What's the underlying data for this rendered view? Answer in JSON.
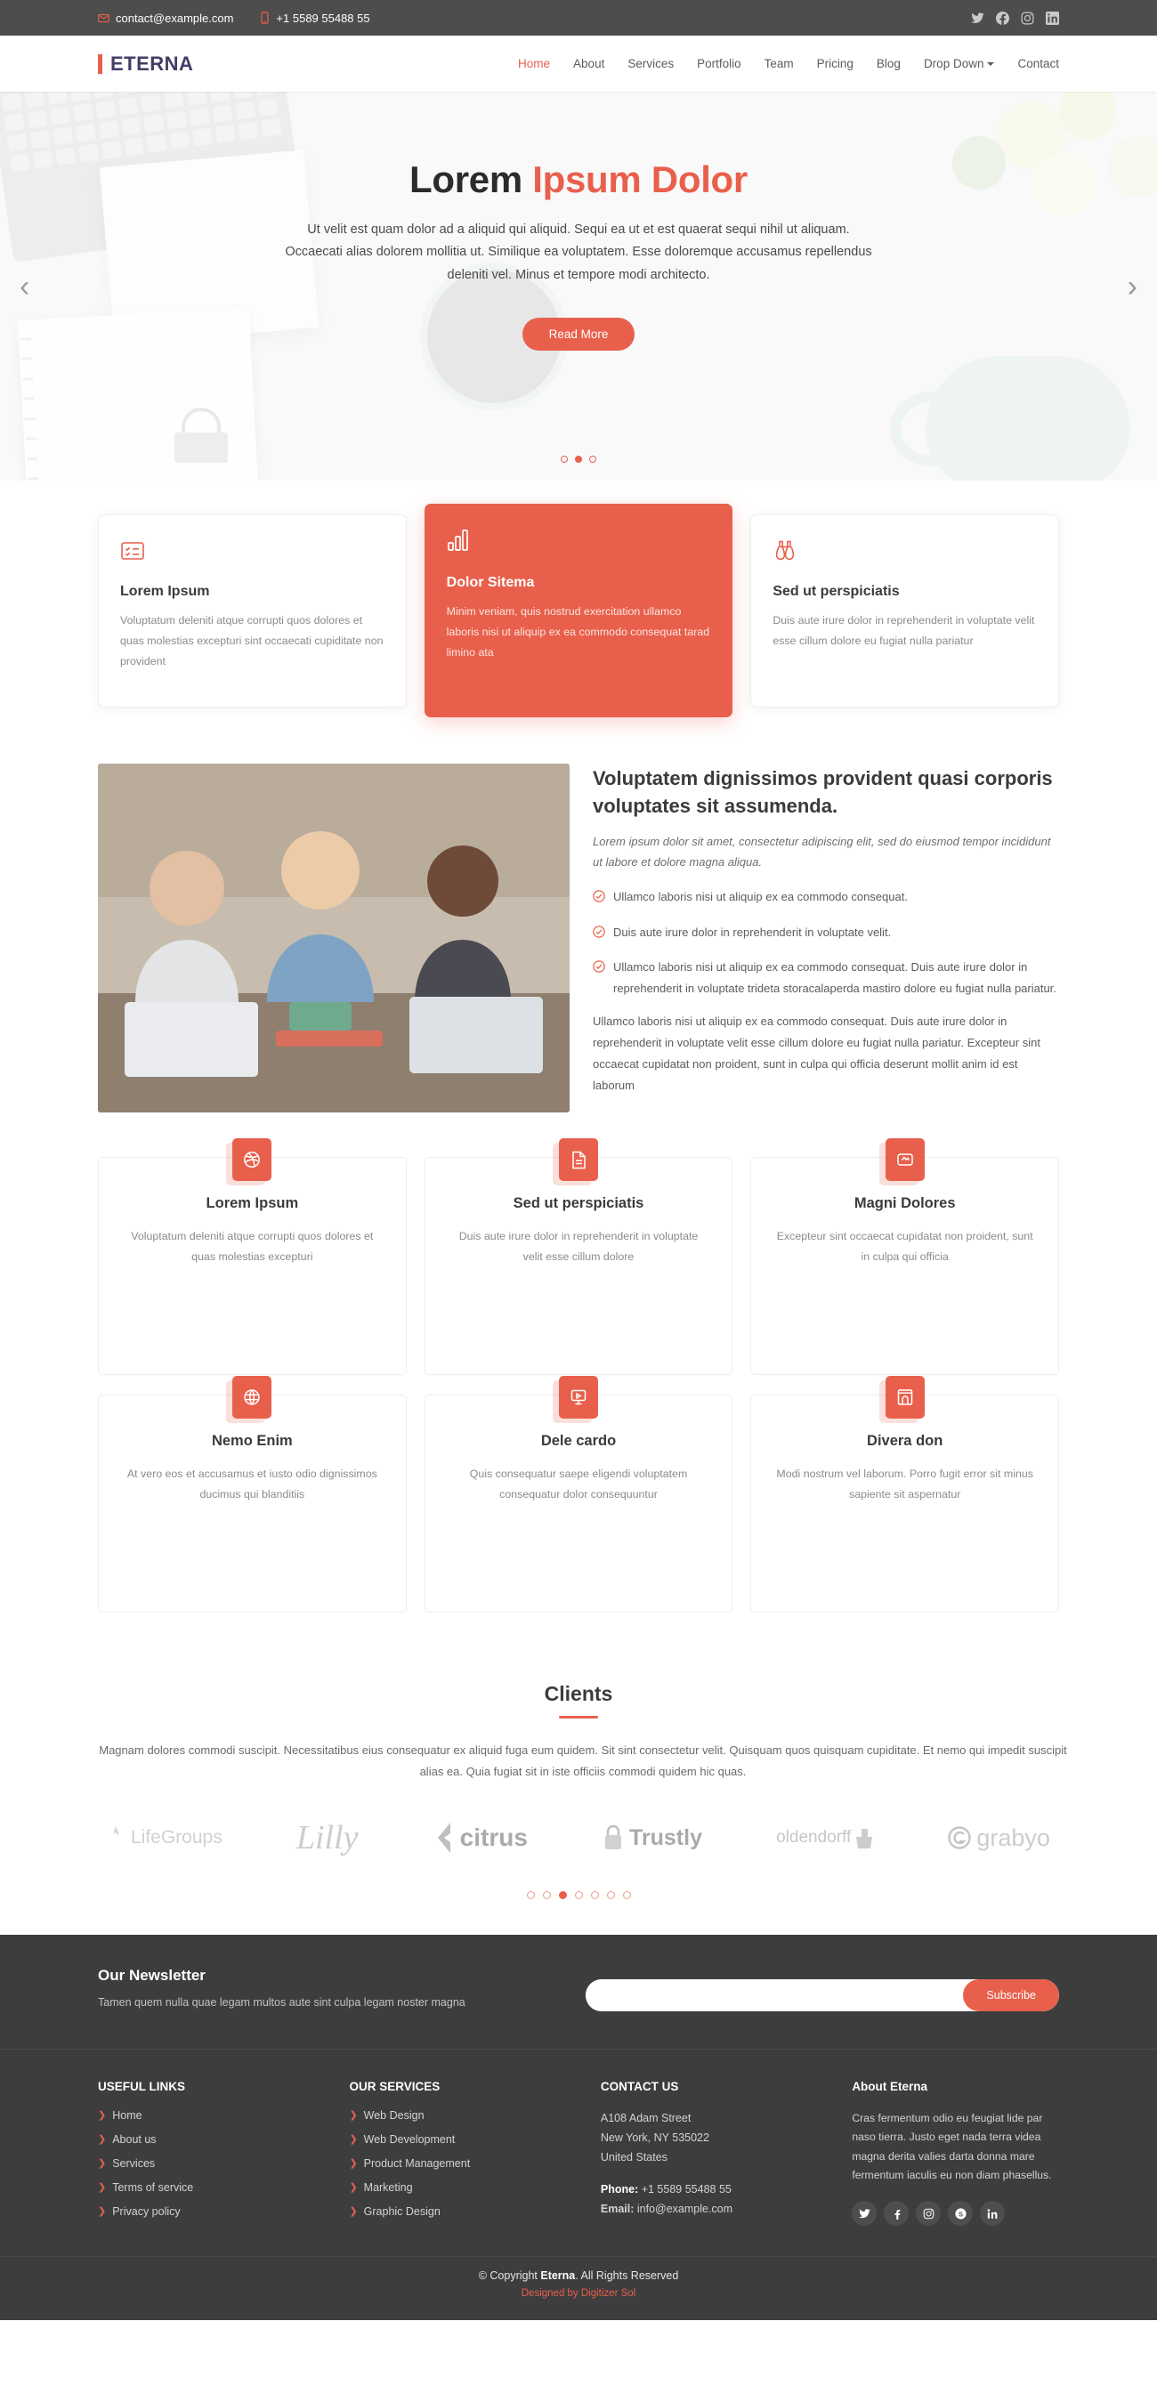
{
  "topbar": {
    "email": "contact@example.com",
    "phone": "+1 5589 55488 55",
    "social": [
      {
        "name": "twitter-icon",
        "label": "Twitter"
      },
      {
        "name": "facebook-icon",
        "label": "Facebook"
      },
      {
        "name": "instagram-icon",
        "label": "Instagram"
      },
      {
        "name": "linkedin-icon",
        "label": "LinkedIn"
      }
    ]
  },
  "header": {
    "logo": "ETERNA",
    "nav": [
      {
        "label": "Home",
        "active": true
      },
      {
        "label": "About",
        "active": false
      },
      {
        "label": "Services",
        "active": false
      },
      {
        "label": "Portfolio",
        "active": false
      },
      {
        "label": "Team",
        "active": false
      },
      {
        "label": "Pricing",
        "active": false
      },
      {
        "label": "Blog",
        "active": false
      },
      {
        "label": "Drop Down",
        "active": false,
        "dropdown": true
      },
      {
        "label": "Contact",
        "active": false
      }
    ]
  },
  "hero": {
    "title_plain": "Lorem ",
    "title_accent": "Ipsum Dolor",
    "body": "Ut velit est quam dolor ad a aliquid qui aliquid. Sequi ea ut et est quaerat sequi nihil ut aliquam. Occaecati alias dolorem mollitia ut. Similique ea voluptatem. Esse doloremque accusamus repellendus deleniti vel. Minus et tempore modi architecto.",
    "cta": "Read More",
    "slide_count": 3,
    "active_slide": 2,
    "prev_icon": "chevron-left-icon",
    "next_icon": "chevron-right-icon"
  },
  "features": [
    {
      "icon": "checklist-icon",
      "title": "Lorem Ipsum",
      "text": "Voluptatum deleniti atque corrupti quos dolores et quas molestias excepturi sint occaecati cupiditate non provident",
      "highlight": false
    },
    {
      "icon": "bar-chart-icon",
      "title": "Dolor Sitema",
      "text": "Minim veniam, quis nostrud exercitation ullamco laboris nisi ut aliquip ex ea commodo consequat tarad limino ata",
      "highlight": true
    },
    {
      "icon": "binoculars-icon",
      "title": "Sed ut perspiciatis",
      "text": "Duis aute irure dolor in reprehenderit in voluptate velit esse cillum dolore eu fugiat nulla pariatur",
      "highlight": false
    }
  ],
  "about": {
    "image_alt": "team-collaboration-photo",
    "heading": "Voluptatem dignissimos provident quasi corporis voluptates sit assumenda.",
    "lead": "Lorem ipsum dolor sit amet, consectetur adipiscing elit, sed do eiusmod tempor incididunt ut labore et dolore magna aliqua.",
    "bullets": [
      "Ullamco laboris nisi ut aliquip ex ea commodo consequat.",
      "Duis aute irure dolor in reprehenderit in voluptate velit.",
      "Ullamco laboris nisi ut aliquip ex ea commodo consequat. Duis aute irure dolor in reprehenderit in voluptate trideta storacalaperda mastiro dolore eu fugiat nulla pariatur."
    ],
    "tail": "Ullamco laboris nisi ut aliquip ex ea commodo consequat. Duis aute irure dolor in reprehenderit in voluptate velit esse cillum dolore eu fugiat nulla pariatur. Excepteur sint occaecat cupidatat non proident, sunt in culpa qui officia deserunt mollit anim id est laborum"
  },
  "services": [
    {
      "icon": "dribbble-icon",
      "title": "Lorem Ipsum",
      "text": "Voluptatum deleniti atque corrupti quos dolores et quas molestias excepturi"
    },
    {
      "icon": "file-icon",
      "title": "Sed ut perspiciatis",
      "text": "Duis aute irure dolor in reprehenderit in voluptate velit esse cillum dolore"
    },
    {
      "icon": "tag-icon",
      "title": "Magni Dolores",
      "text": "Excepteur sint occaecat cupidatat non proident, sunt in culpa qui officia"
    },
    {
      "icon": "globe-icon",
      "title": "Nemo Enim",
      "text": "At vero eos et accusamus et iusto odio dignissimos ducimus qui blanditiis"
    },
    {
      "icon": "slideshow-icon",
      "title": "Dele cardo",
      "text": "Quis consequatur saepe eligendi voluptatem consequatur dolor consequuntur"
    },
    {
      "icon": "archway-icon",
      "title": "Divera don",
      "text": "Modi nostrum vel laborum. Porro fugit error sit minus sapiente sit aspernatur"
    }
  ],
  "clients": {
    "title": "Clients",
    "desc": "Magnam dolores commodi suscipit. Necessitatibus eius consequatur ex aliquid fuga eum quidem. Sit sint consectetur velit. Quisquam quos quisquam cupiditate. Et nemo qui impedit suscipit alias ea. Quia fugiat sit in iste officiis commodi quidem hic quas.",
    "logos": [
      "LifeGroups",
      "Lilly",
      "citrus",
      "Trustly",
      "oldendorff",
      "grabyo"
    ],
    "dot_count": 7,
    "active_dot": 3
  },
  "newsletter": {
    "title": "Our Newsletter",
    "text": "Tamen quem nulla quae legam multos aute sint culpa legam noster magna",
    "input_placeholder": "",
    "input_value": "",
    "button": "Subscribe"
  },
  "footer": {
    "useful_links": {
      "title": "USEFUL LINKS",
      "items": [
        "Home",
        "About us",
        "Services",
        "Terms of service",
        "Privacy policy"
      ]
    },
    "our_services": {
      "title": "OUR SERVICES",
      "items": [
        "Web Design",
        "Web Development",
        "Product Management",
        "Marketing",
        "Graphic Design"
      ]
    },
    "contact": {
      "title": "CONTACT US",
      "line1": "A108 Adam Street",
      "line2": "New York, NY 535022",
      "line3": "United States",
      "phone_label": "Phone:",
      "phone": " +1 5589 55488 55",
      "email_label": "Email:",
      "email": " info@example.com"
    },
    "about": {
      "title": "About Eterna",
      "text": "Cras fermentum odio eu feugiat lide par naso tierra. Justo eget nada terra videa magna derita valies darta donna mare fermentum iaculis eu non diam phasellus.",
      "social": [
        {
          "name": "twitter-icon",
          "label": "Twitter"
        },
        {
          "name": "facebook-icon",
          "label": "Facebook"
        },
        {
          "name": "instagram-icon",
          "label": "Instagram"
        },
        {
          "name": "skype-icon",
          "label": "Skype"
        },
        {
          "name": "linkedin-icon",
          "label": "LinkedIn"
        }
      ]
    },
    "copyright_pre": "© Copyright ",
    "copyright_brand": "Eterna",
    "copyright_post": ". All Rights Reserved",
    "designed_pre": "Designed by ",
    "designed_by": "Digitizer Sol"
  },
  "colors": {
    "accent": "#e8604c",
    "dark": "#3d3d3d",
    "topbar": "#4d4d4d"
  }
}
